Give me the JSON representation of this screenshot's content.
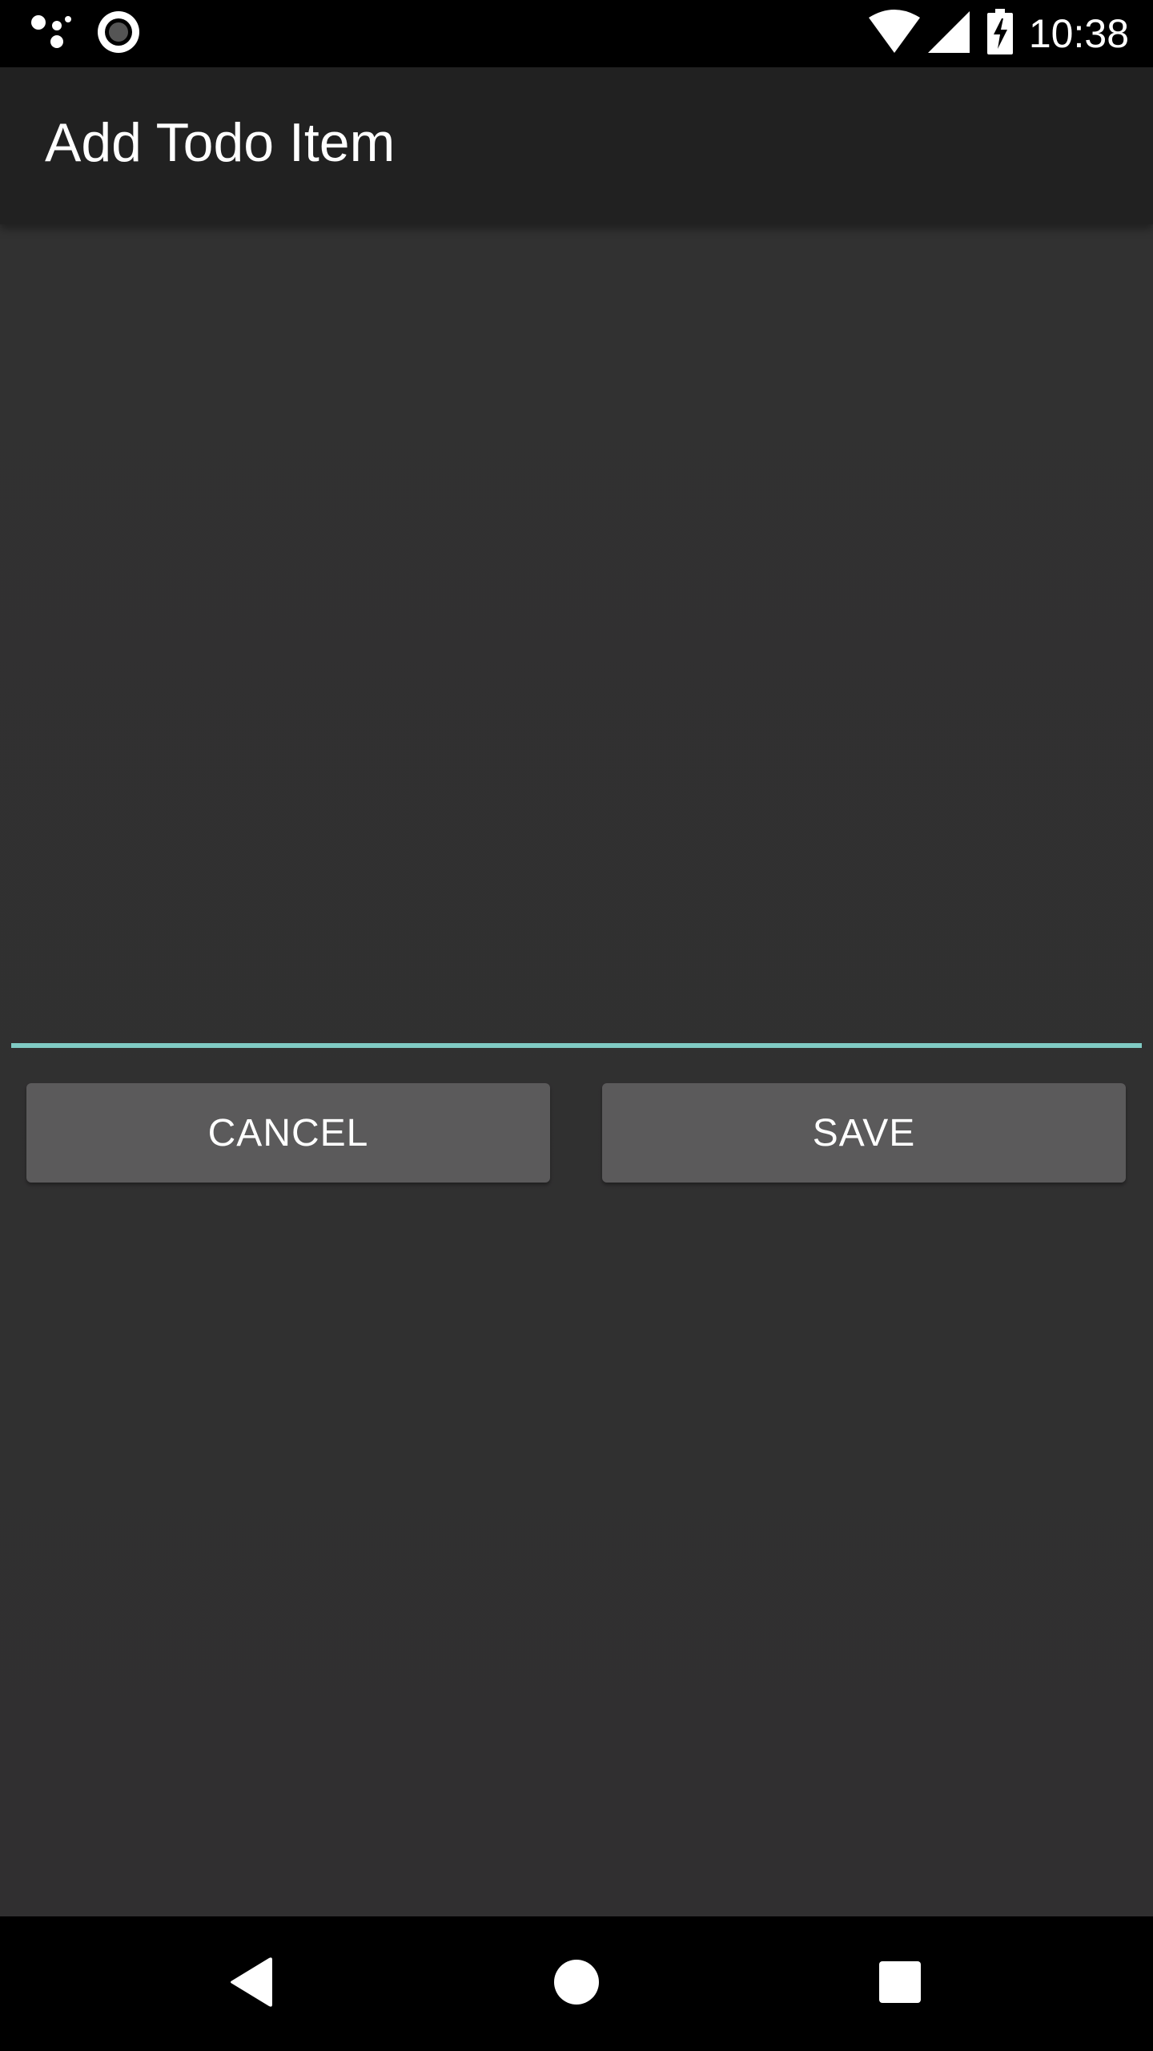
{
  "status_bar": {
    "time": "10:38",
    "icons": [
      "assistant-dots-icon",
      "record-icon",
      "wifi-icon",
      "cell-signal-icon",
      "battery-charging-icon"
    ]
  },
  "app_bar": {
    "title": "Add Todo Item"
  },
  "form": {
    "todo_value": "",
    "cancel_label": "CANCEL",
    "save_label": "SAVE"
  },
  "nav_bar": {
    "icons": [
      "back-icon",
      "home-icon",
      "recents-icon"
    ]
  },
  "colors": {
    "background": "#303030",
    "app_bar": "#212121",
    "accent": "#80cbc4",
    "button": "#5b5a5b"
  }
}
